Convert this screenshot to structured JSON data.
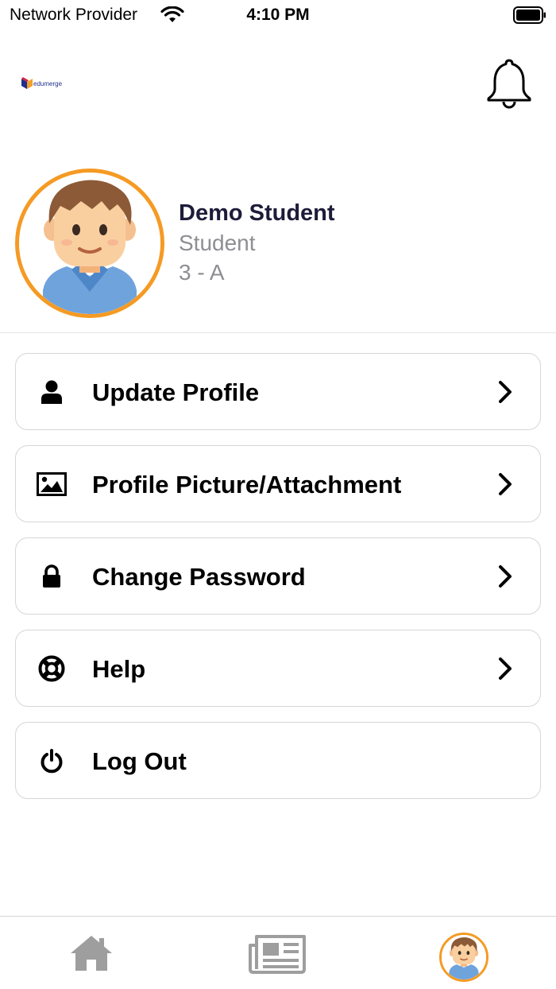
{
  "status_bar": {
    "carrier": "Network Provider",
    "time": "4:10 PM"
  },
  "header": {
    "logo_text": "edumerge",
    "logo_icon": "edumerge-logo",
    "notification_icon": "bell-icon"
  },
  "profile": {
    "name": "Demo Student",
    "role": "Student",
    "class": "3 - A",
    "avatar_border_color": "#f59a23"
  },
  "menu": {
    "items": [
      {
        "label": "Update Profile",
        "icon": "user-icon",
        "has_chevron": true
      },
      {
        "label": "Profile Picture/Attachment",
        "icon": "image-icon",
        "has_chevron": true
      },
      {
        "label": "Change Password",
        "icon": "lock-icon",
        "has_chevron": true
      },
      {
        "label": "Help",
        "icon": "lifebuoy-icon",
        "has_chevron": true
      },
      {
        "label": "Log Out",
        "icon": "power-icon",
        "has_chevron": false
      }
    ]
  },
  "tabbar": {
    "tabs": [
      {
        "name": "home",
        "icon": "home-icon"
      },
      {
        "name": "news",
        "icon": "newspaper-icon"
      },
      {
        "name": "profile",
        "icon": "avatar-icon",
        "active": true
      }
    ]
  }
}
